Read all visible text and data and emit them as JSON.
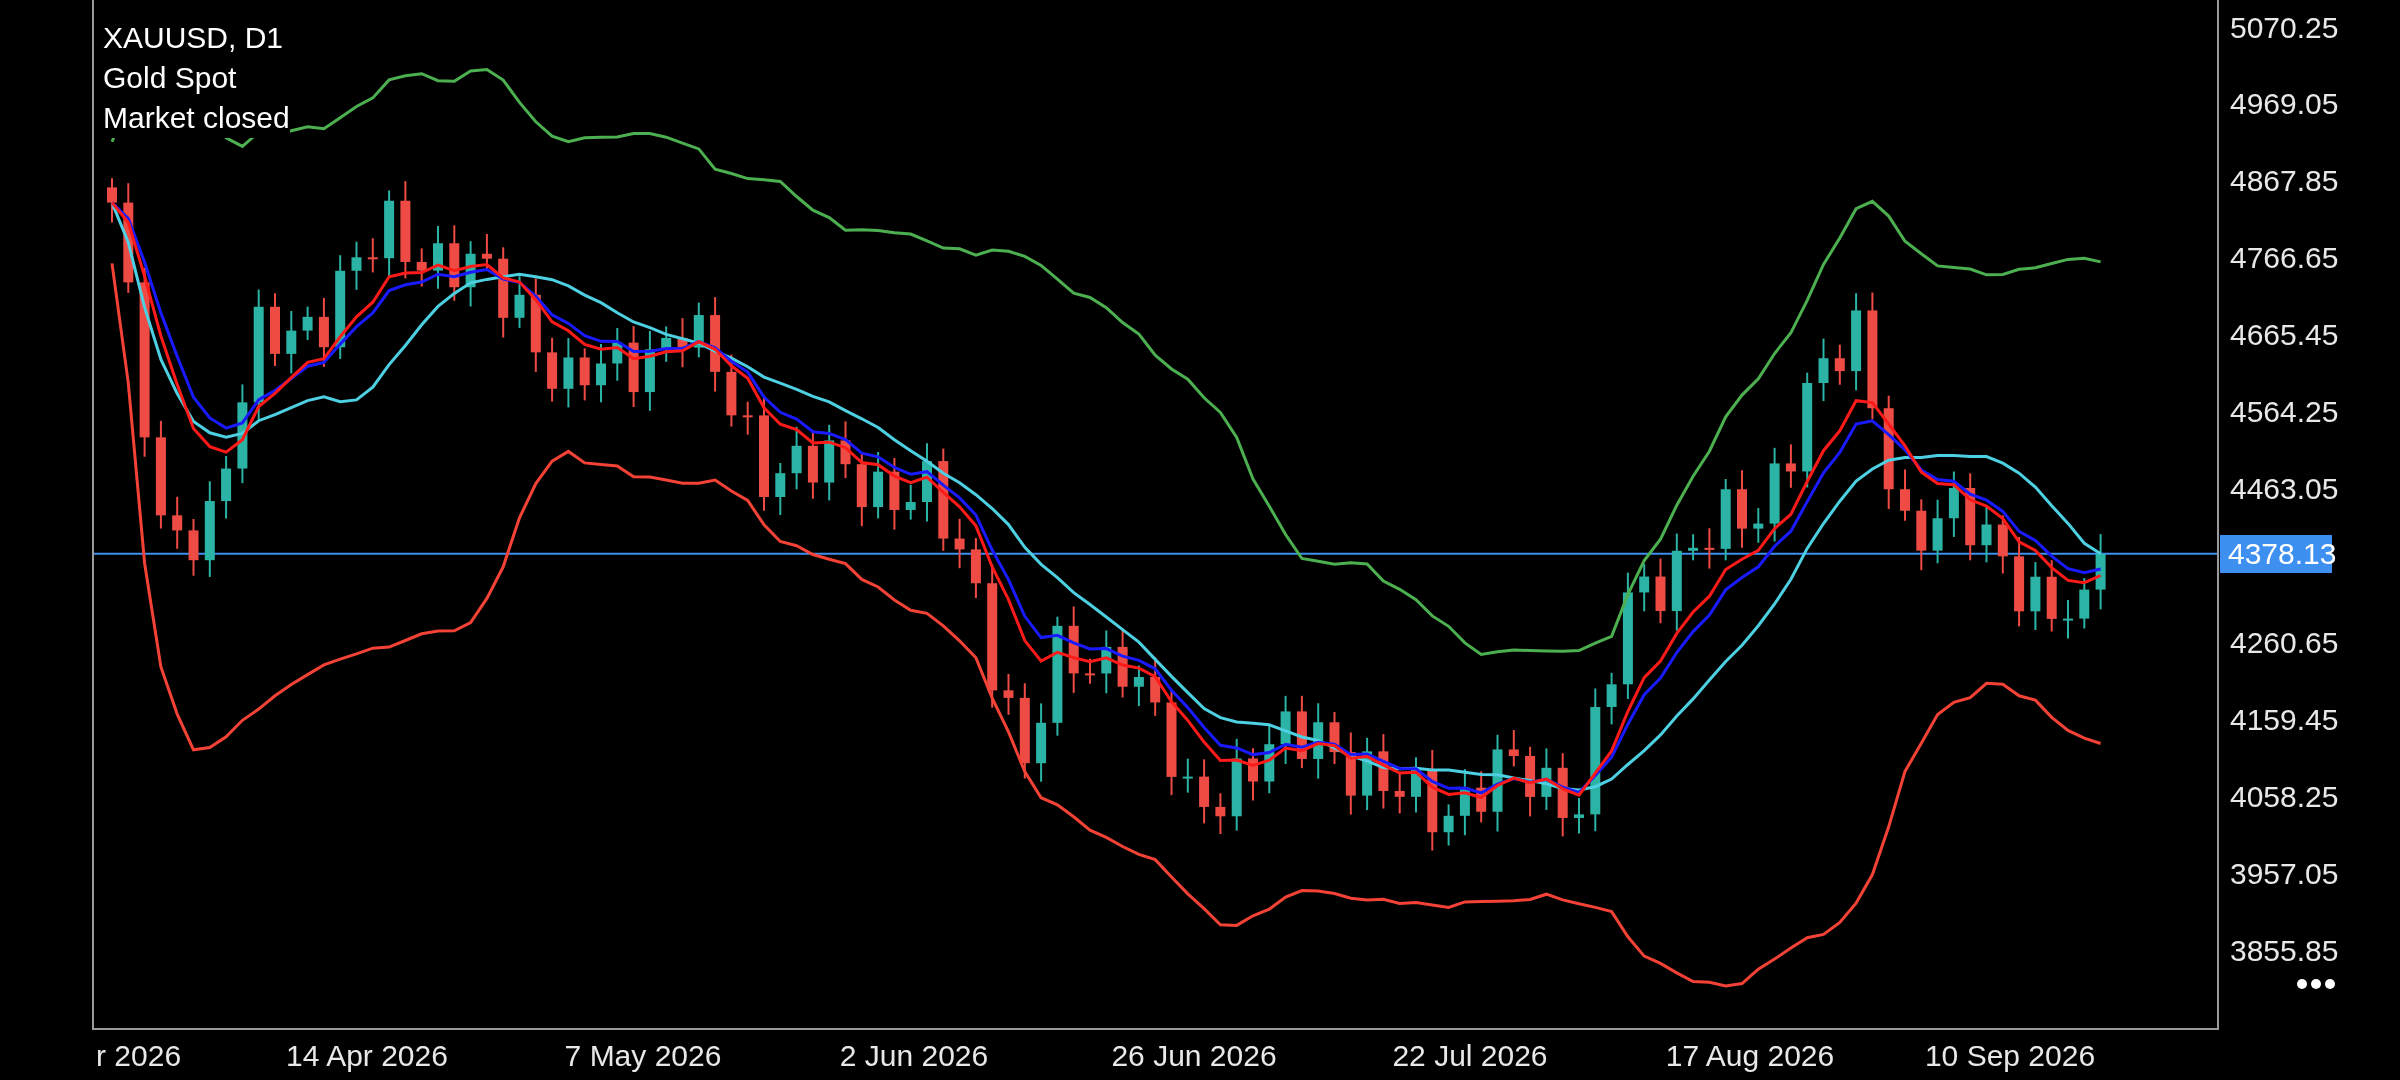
{
  "chart": {
    "symbol": "XAUUSD, D1",
    "description": "Gold Spot",
    "status": "Market closed"
  },
  "price_axis": {
    "labels": [
      "5070.25",
      "4969.05",
      "4867.85",
      "4766.65",
      "4665.45",
      "4564.25",
      "4463.05",
      "4260.65",
      "4159.45",
      "4058.25",
      "3957.05",
      "3855.85"
    ],
    "current_price": "4378.13"
  },
  "time_axis": {
    "labels": [
      "r 2026",
      "14 Apr 2026",
      "7 May 2026",
      "2 Jun 2026",
      "26 Jun 2026",
      "22 Jul 2026",
      "17 Aug 2026",
      "10 Sep 2026"
    ]
  }
}
